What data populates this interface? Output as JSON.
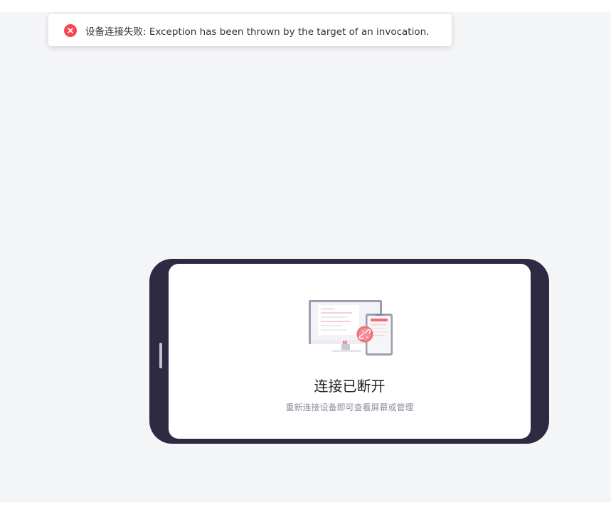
{
  "toast": {
    "icon": "error-circle-icon",
    "message": "设备连接失败: Exception has been thrown by the target of an invocation.",
    "color": "#f5474f"
  },
  "device": {
    "illustration": "disconnected-devices-icon",
    "title": "连接已断开",
    "subtitle": "重新连接设备即可查看屏幕或管理"
  },
  "colors": {
    "background": "#f4f5f7",
    "phone_frame": "#2e2a42",
    "accent": "#f5474f"
  }
}
